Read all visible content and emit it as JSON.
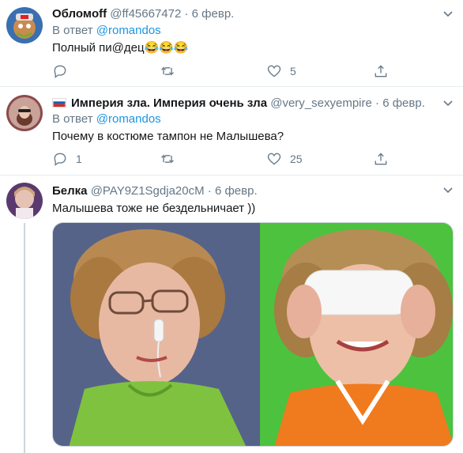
{
  "tweets": [
    {
      "name": "Обломoff",
      "handle": "@ff45667472",
      "sep": "·",
      "date": "6 февр.",
      "reply_prefix": "В ответ",
      "reply_to": "@romandos",
      "text": "Полный пи@дец😂😂😂",
      "replies": "",
      "likes": "5"
    },
    {
      "name": "Империя зла. Империя очень зла",
      "handle": "@very_sexyempire",
      "sep": "·",
      "date": "6 февр.",
      "reply_prefix": "В ответ",
      "reply_to": "@romandos",
      "text": "Почему в костюме тампон не Малышева?",
      "replies": "1",
      "likes": "25"
    },
    {
      "name": "Белка",
      "handle": "@PAY9Z1Sgdja20cM",
      "sep": "·",
      "date": "6 февр.",
      "text": "Малышева тоже не бездельничает ))"
    }
  ],
  "icons": {
    "reply": "reply-icon",
    "retweet": "retweet-icon",
    "like": "heart-icon",
    "share": "share-icon",
    "caret": "chevron-down-icon",
    "flag": "russia-flag-icon"
  },
  "colors": {
    "link": "#1b95e0",
    "muted": "#657786",
    "text": "#14171a",
    "border": "#e6ecf0"
  }
}
